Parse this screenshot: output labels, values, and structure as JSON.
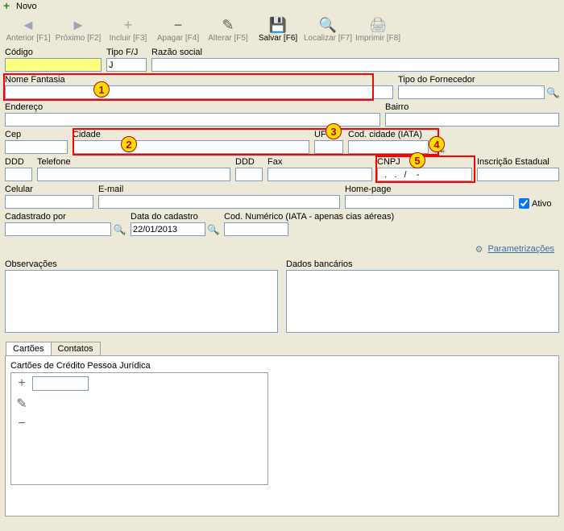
{
  "header": {
    "title": "Novo"
  },
  "toolbar": {
    "anterior": "Anterior [F1]",
    "proximo": "Próximo [F2]",
    "incluir": "Incluir [F3]",
    "apagar": "Apagar [F4]",
    "alterar": "Alterar [F5]",
    "salvar": "Salvar [F6]",
    "localizar": "Localizar [F7]",
    "imprimir": "Imprimir [F8]"
  },
  "labels": {
    "codigo": "Código",
    "tipofj": "Tipo F/J",
    "razao": "Razão social",
    "nome_fantasia": "Nome Fantasia",
    "tipo_fornecedor": "Tipo do Fornecedor",
    "endereco": "Endereço",
    "bairro": "Bairro",
    "cep": "Cep",
    "cidade": "Cidade",
    "uf": "UF",
    "cod_cidade": "Cod. cidade (IATA)",
    "ddd": "DDD",
    "telefone": "Telefone",
    "fax": "Fax",
    "cnpj": "CNPJ",
    "insc_est": "Inscrição Estadual",
    "celular": "Celular",
    "email": "E-mail",
    "homepage": "Home-page",
    "ativo": "Ativo",
    "cadastrado_por": "Cadastrado por",
    "data_cadastro": "Data do cadastro",
    "cod_numerico": "Cod. Numérico (IATA - apenas cias aéreas)",
    "parametrizacoes": "Parametrizações",
    "observacoes": "Observações",
    "dados_bancarios": "Dados bancários",
    "cartoes_tab": "Cartões",
    "contatos_tab": "Contatos",
    "cartoes_grupo": "Cartões de Crédito Pessoa Jurídica"
  },
  "values": {
    "codigo": "",
    "tipofj": "J",
    "razao": "",
    "nome_fantasia": "",
    "tipo_fornecedor": "",
    "endereco": "",
    "bairro": "",
    "cep": "",
    "cidade": "",
    "uf": "",
    "cod_cidade": "",
    "ddd1": "",
    "telefone": "",
    "ddd2": "",
    "fax": "",
    "cnpj": "  .   .   /    -",
    "insc_est": "",
    "celular": "",
    "email": "",
    "homepage": "",
    "ativo_checked": true,
    "cadastrado_por": "",
    "data_cadastro": "22/01/2013",
    "cod_numerico": ""
  },
  "markers": {
    "m1": "1",
    "m2": "2",
    "m3": "3",
    "m4": "4",
    "m5": "5"
  }
}
